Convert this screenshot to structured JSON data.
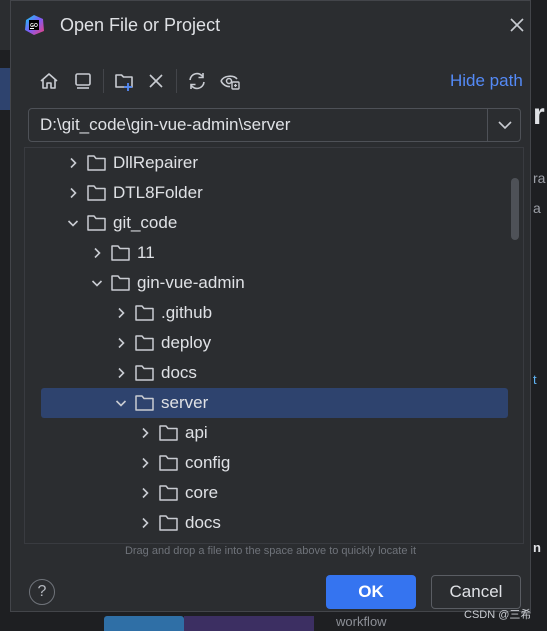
{
  "dialog": {
    "title": "Open File or Project",
    "app_icon": "goland-icon",
    "close_icon": "close-icon"
  },
  "toolbar": {
    "icons": [
      "home-icon",
      "desktop-icon",
      "new-folder-icon",
      "delete-icon",
      "refresh-icon",
      "show-hidden-icon"
    ],
    "hide_path_label": "Hide path"
  },
  "path": {
    "value": "D:\\git_code\\gin-vue-admin\\server"
  },
  "tree": {
    "rows": [
      {
        "label": "DllRepairer",
        "depth": 0,
        "expanded": false,
        "selected": false
      },
      {
        "label": "DTL8Folder",
        "depth": 0,
        "expanded": false,
        "selected": false
      },
      {
        "label": "git_code",
        "depth": 0,
        "expanded": true,
        "selected": false
      },
      {
        "label": "11",
        "depth": 1,
        "expanded": false,
        "selected": false
      },
      {
        "label": "gin-vue-admin",
        "depth": 1,
        "expanded": true,
        "selected": false
      },
      {
        "label": ".github",
        "depth": 2,
        "expanded": false,
        "selected": false
      },
      {
        "label": "deploy",
        "depth": 2,
        "expanded": false,
        "selected": false
      },
      {
        "label": "docs",
        "depth": 2,
        "expanded": false,
        "selected": false
      },
      {
        "label": "server",
        "depth": 2,
        "expanded": true,
        "selected": true
      },
      {
        "label": "api",
        "depth": 3,
        "expanded": false,
        "selected": false
      },
      {
        "label": "config",
        "depth": 3,
        "expanded": false,
        "selected": false
      },
      {
        "label": "core",
        "depth": 3,
        "expanded": false,
        "selected": false
      },
      {
        "label": "docs",
        "depth": 3,
        "expanded": false,
        "selected": false
      }
    ]
  },
  "hint": "Drag and drop a file into the space above to quickly locate it",
  "buttons": {
    "help": "?",
    "ok": "OK",
    "cancel": "Cancel"
  },
  "watermark": "CSDN @三希",
  "colors": {
    "background": "#2b2d30",
    "selection": "#2e436e",
    "accent": "#3574f0",
    "link": "#548af7"
  }
}
